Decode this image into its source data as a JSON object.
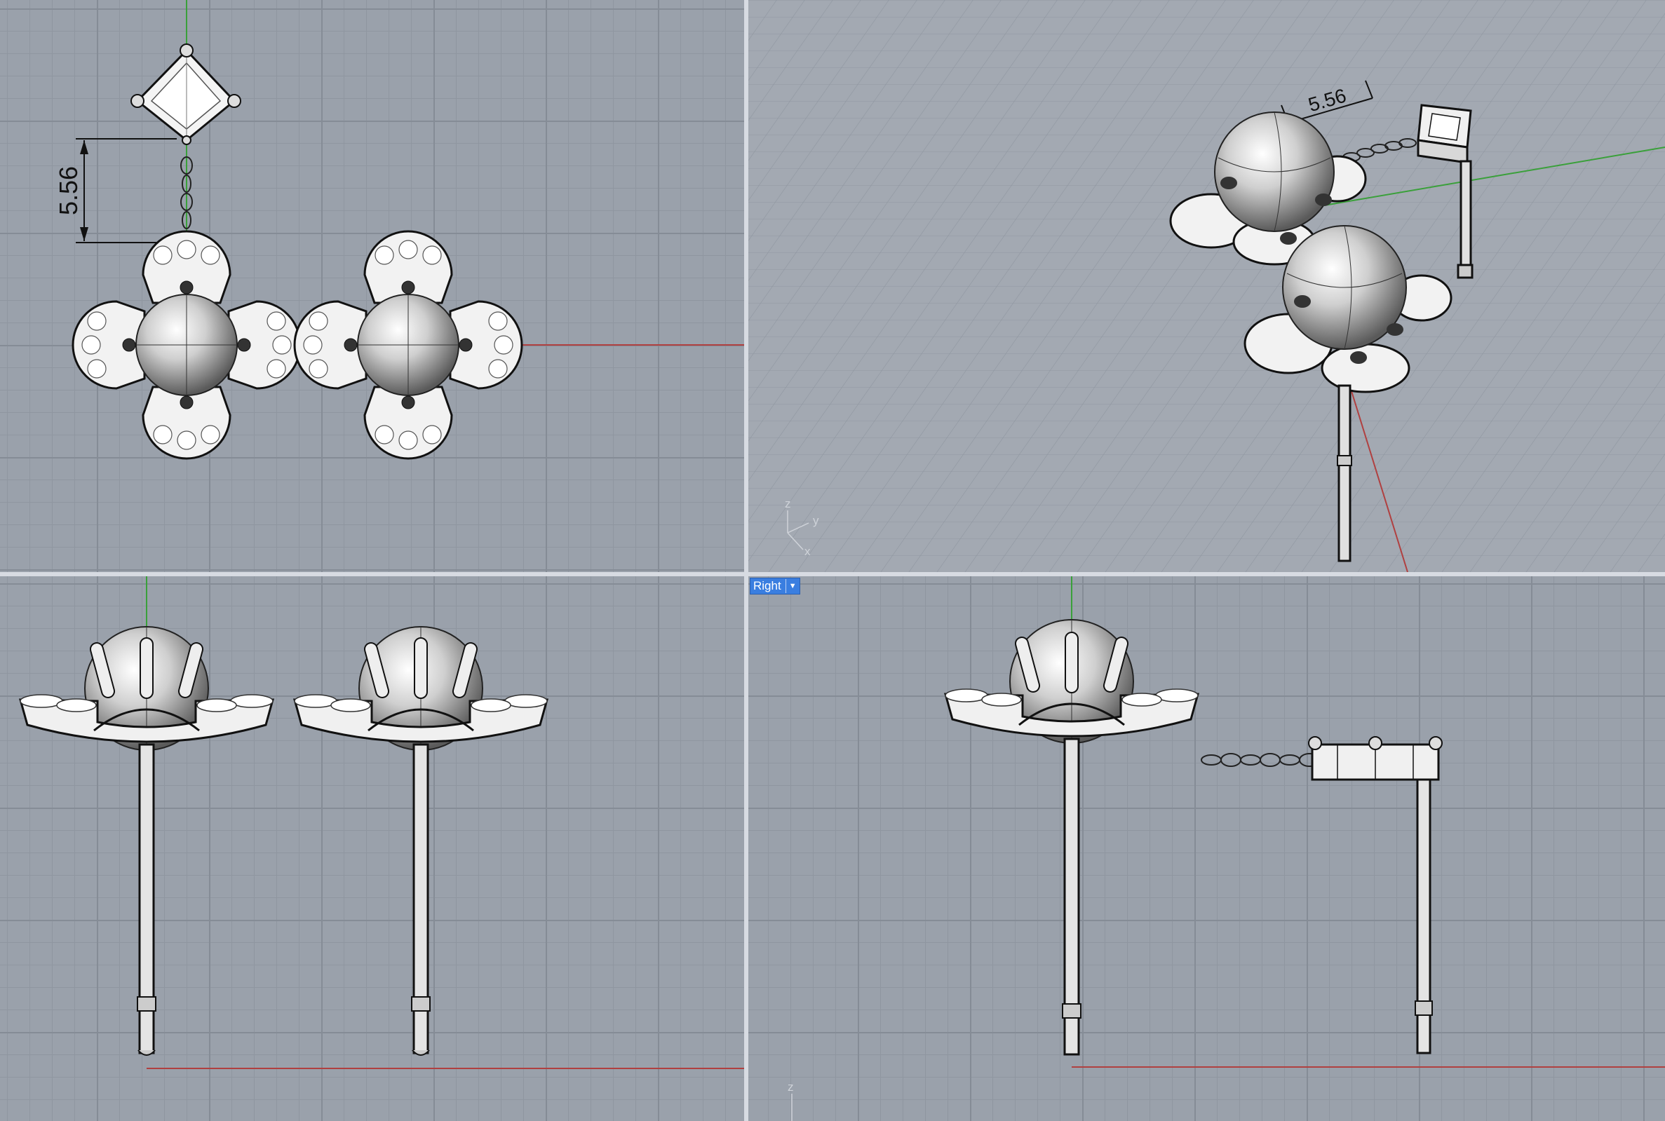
{
  "viewports": {
    "top": {
      "dimension": "5.56"
    },
    "perspective": {
      "dimension": "5.56",
      "axis_labels": {
        "z": "z",
        "y": "y",
        "x": "x"
      }
    },
    "front": {},
    "right": {
      "label": "Right",
      "dropdown_icon": "chevron-down-icon",
      "axis_labels": {
        "z": "z"
      }
    }
  },
  "colors": {
    "x_axis": "#b04040",
    "y_axis": "#3aa03a",
    "viewport_background": "#9aa1ab",
    "label_background": "#3a7ee0"
  }
}
